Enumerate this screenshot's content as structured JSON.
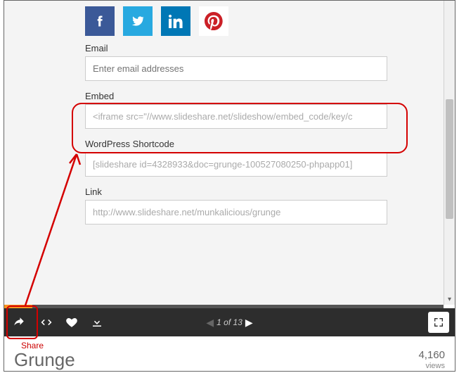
{
  "share": {
    "emailLabel": "Email",
    "emailPlaceholder": "Enter email addresses",
    "embedLabel": "Embed",
    "embedValue": "<iframe src=\"//www.slideshare.net/slideshow/embed_code/key/c",
    "wpLabel": "WordPress Shortcode",
    "wpValue": "[slideshare id=4328933&doc=grunge-100527080250-phpapp01]",
    "linkLabel": "Link",
    "linkValue": "http://www.slideshare.net/munkalicious/grunge"
  },
  "player": {
    "positionText": "1 of 13"
  },
  "annotation": {
    "shareCaption": "Share"
  },
  "footer": {
    "title": "Grunge",
    "viewsCount": "4,160",
    "viewsLabel": "views"
  }
}
